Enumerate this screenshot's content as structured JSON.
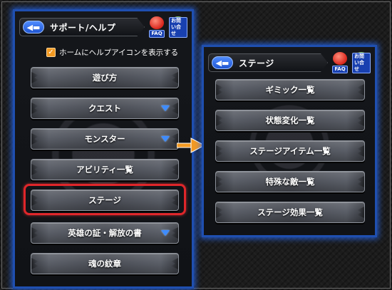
{
  "left_panel": {
    "title": "サポート/ヘルプ",
    "back_icon": "back-arrow-icon",
    "faq_label": "FAQ",
    "help_label": "お問い合せ",
    "checkbox_label": "ホームにヘルプアイコンを表示する",
    "checkbox_checked": true,
    "menu": [
      {
        "label": "遊び方",
        "has_dropdown": false
      },
      {
        "label": "クエスト",
        "has_dropdown": true
      },
      {
        "label": "モンスター",
        "has_dropdown": true
      },
      {
        "label": "アビリティ一覧",
        "has_dropdown": false
      },
      {
        "label": "ステージ",
        "has_dropdown": false,
        "highlighted": true
      },
      {
        "label": "英雄の証・解放の書",
        "has_dropdown": true
      },
      {
        "label": "魂の紋章",
        "has_dropdown": false
      }
    ]
  },
  "right_panel": {
    "title": "ステージ",
    "back_icon": "back-arrow-icon",
    "faq_label": "FAQ",
    "help_label": "お問い合せ",
    "menu": [
      {
        "label": "ギミック一覧"
      },
      {
        "label": "状態変化一覧"
      },
      {
        "label": "ステージアイテム一覧"
      },
      {
        "label": "特殊な敵一覧"
      },
      {
        "label": "ステージ効果一覧"
      }
    ]
  },
  "colors": {
    "panel_glow": "#2f6fff",
    "highlight": "#e0262a",
    "arrow": "#f39a22",
    "dropdown_chevron": "#3e8cff"
  }
}
